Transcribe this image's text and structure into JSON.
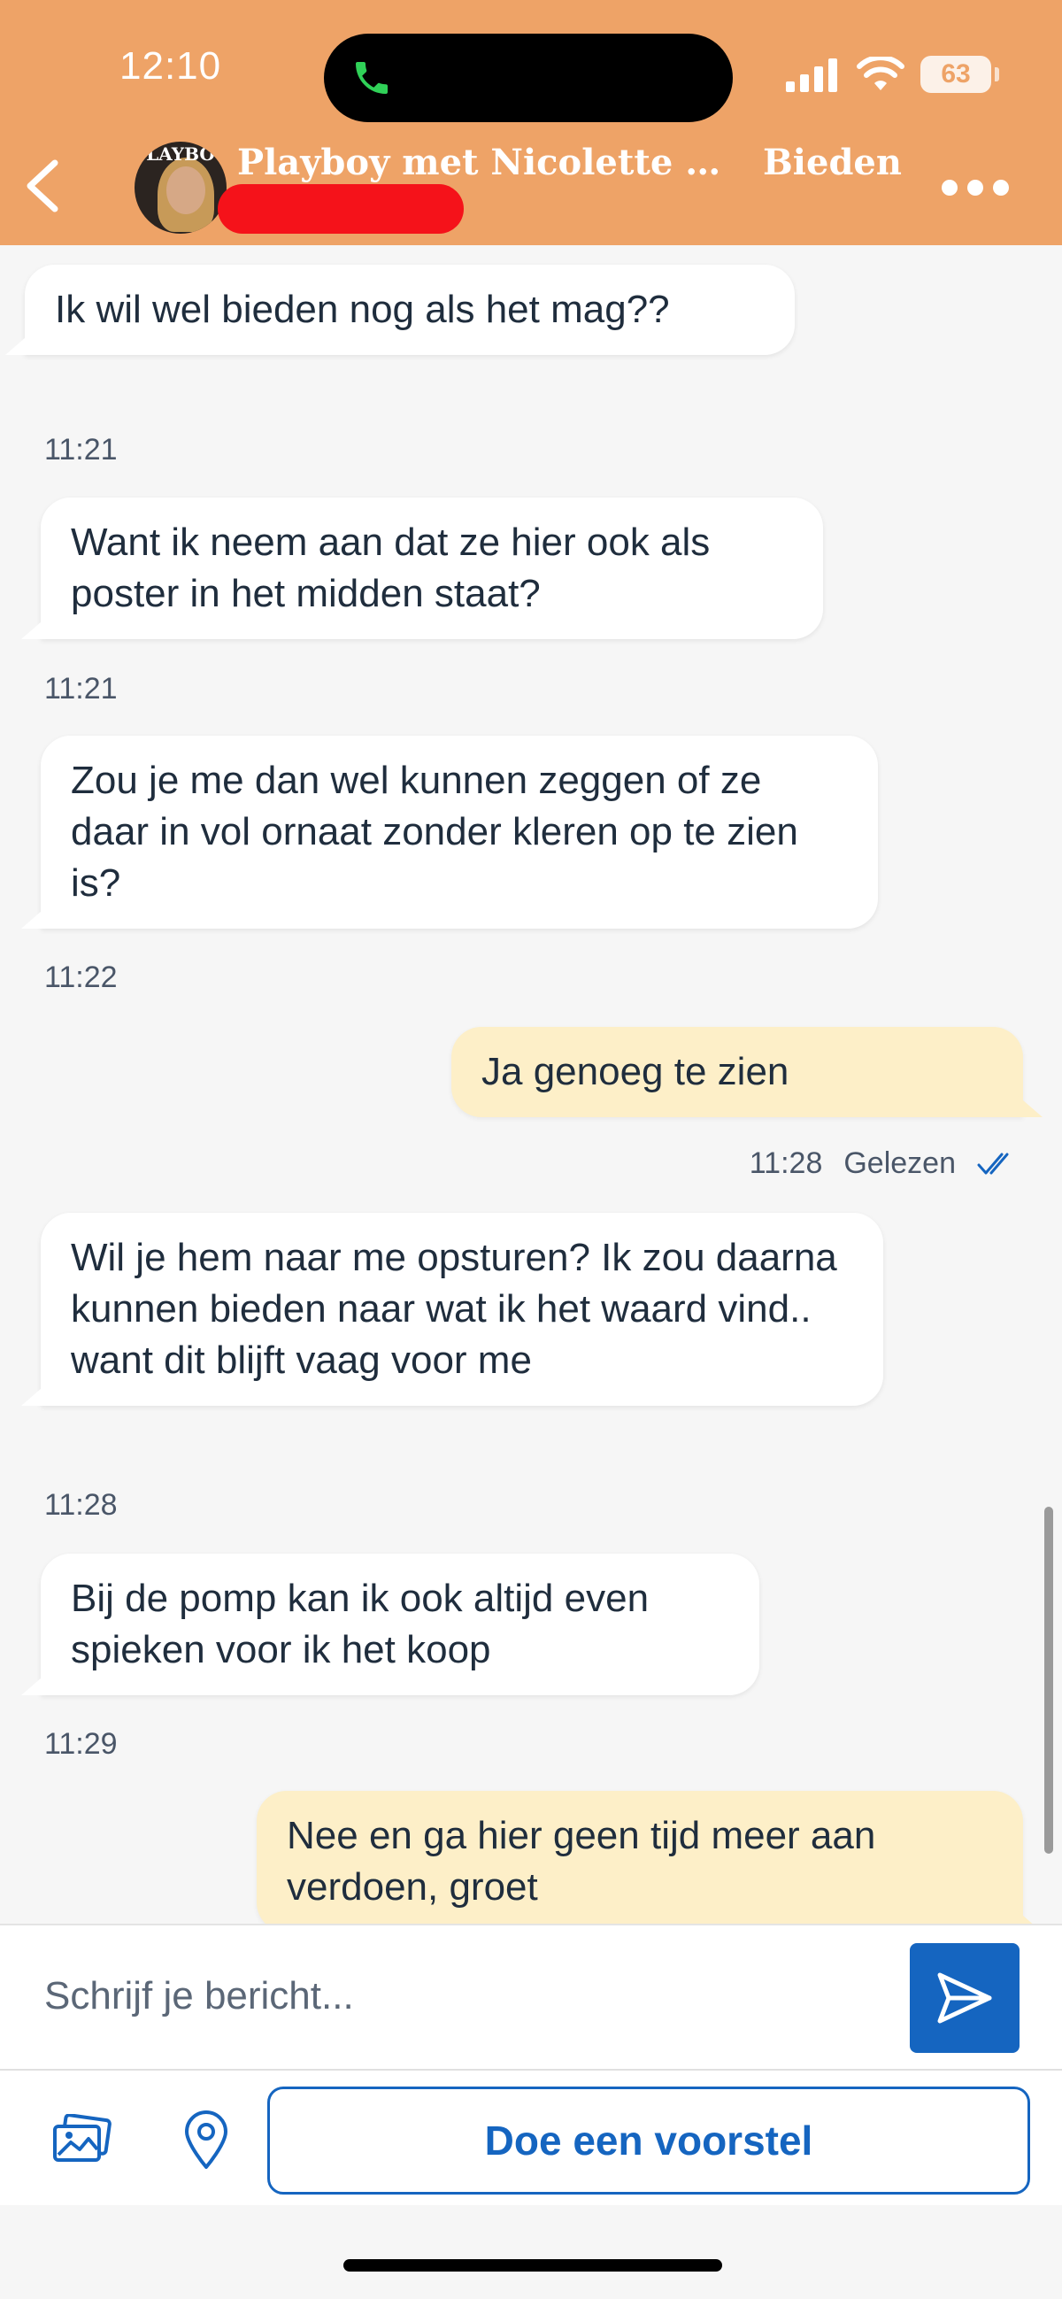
{
  "status_bar": {
    "time": "12:10",
    "battery": "63",
    "icons": [
      "phone-call-icon",
      "signal-icon",
      "wifi-icon",
      "battery-icon"
    ]
  },
  "header": {
    "title": "Playboy met Nicolette Klu...",
    "action": "Bieden",
    "avatar_text": "LAYBO",
    "icons": [
      "back-chevron-icon",
      "more-dots-icon"
    ]
  },
  "messages": [
    {
      "direction": "in",
      "text": "Ik wil wel bieden nog als het mag??",
      "time": "11:21"
    },
    {
      "direction": "in",
      "text": "Want ik neem aan dat ze hier ook als poster in het midden staat?",
      "time": "11:21"
    },
    {
      "direction": "in",
      "text": "Zou je me dan wel kunnen zeggen of ze daar in vol ornaat zonder kleren op te zien is?",
      "time": "11:22"
    },
    {
      "direction": "out",
      "text": "Ja genoeg te zien",
      "time": "11:28",
      "status": "Gelezen"
    },
    {
      "direction": "in",
      "text": "Wil je hem naar me opsturen? Ik zou daarna kunnen bieden naar wat ik het waard vind.. want dit blijft vaag voor me",
      "time": "11:28"
    },
    {
      "direction": "in",
      "text": "Bij de pomp kan ik ook altijd even spieken voor ik het koop",
      "time": "11:29"
    },
    {
      "direction": "out",
      "text": "Nee en ga hier geen tijd meer aan verdoen, groet"
    }
  ],
  "composer": {
    "placeholder": "Schrijf je bericht...",
    "icons": [
      "send-icon",
      "gallery-icon",
      "location-pin-icon"
    ]
  },
  "offer_button": "Doe een voorstel",
  "colors": {
    "header": "#eea367",
    "incoming_bubble": "#ffffff",
    "outgoing_bubble": "#fdefc8",
    "accent": "#1565c0",
    "redaction": "#f5121a"
  }
}
